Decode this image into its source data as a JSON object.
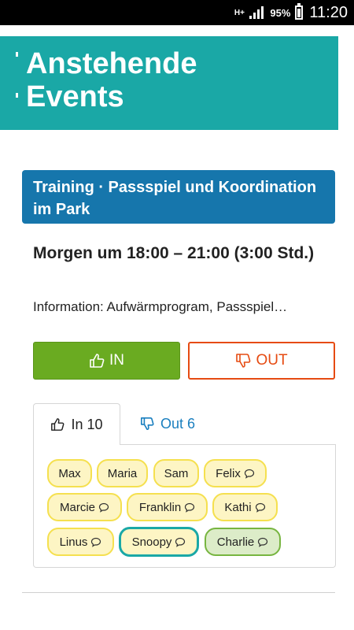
{
  "status_bar": {
    "network": "H+",
    "battery": "95%",
    "time": "11:20"
  },
  "header": {
    "title": "Anstehende Events"
  },
  "event": {
    "title": "Training · Passspiel und Koordination im Park",
    "when": "Morgen um 18:00 – 21:00 (3:00 Std.)",
    "info": "Information: Aufwärmprogram, Passspiel…"
  },
  "actions": {
    "in_label": "IN",
    "out_label": "OUT"
  },
  "tabs": {
    "in_label": "In 10",
    "out_label": "Out 6"
  },
  "participants": [
    {
      "name": "Max",
      "comment": false,
      "style": "normal"
    },
    {
      "name": "Maria",
      "comment": false,
      "style": "normal"
    },
    {
      "name": "Sam",
      "comment": false,
      "style": "normal"
    },
    {
      "name": "Felix",
      "comment": true,
      "style": "normal"
    },
    {
      "name": "Marcie",
      "comment": true,
      "style": "normal"
    },
    {
      "name": "Franklin",
      "comment": true,
      "style": "normal"
    },
    {
      "name": "Kathi",
      "comment": true,
      "style": "normal"
    },
    {
      "name": "Linus",
      "comment": true,
      "style": "normal"
    },
    {
      "name": "Snoopy",
      "comment": true,
      "style": "selected"
    },
    {
      "name": "Charlie",
      "comment": true,
      "style": "green"
    }
  ],
  "colors": {
    "header": "#1aa8a6",
    "event_title": "#1676ac",
    "in": "#6aab21",
    "out": "#e64b12",
    "chip": "#fdf5c4",
    "chip_border": "#f5e04f"
  }
}
